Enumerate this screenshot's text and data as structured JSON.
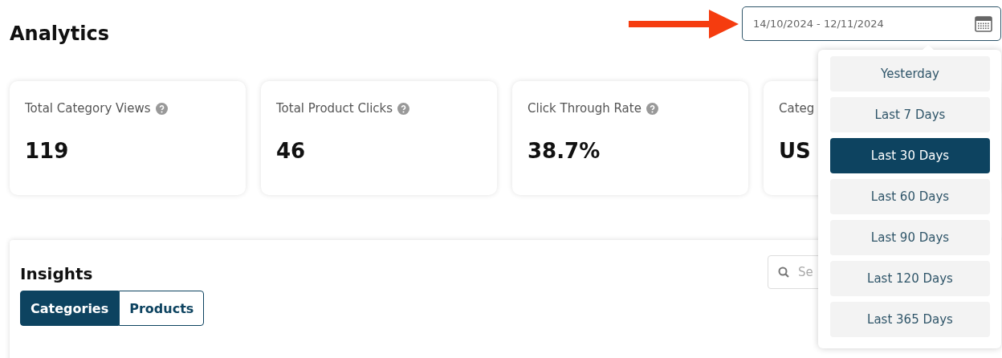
{
  "page": {
    "title": "Analytics"
  },
  "date_range": {
    "value": "14/10/2024 - 12/11/2024"
  },
  "stats": [
    {
      "label": "Total Category Views",
      "help": true,
      "value": "119"
    },
    {
      "label": "Total Product Clicks",
      "help": true,
      "value": "46"
    },
    {
      "label": "Click Through Rate",
      "help": true,
      "value": "38.7%"
    },
    {
      "label": "Categ",
      "help": false,
      "value": "US"
    }
  ],
  "insights": {
    "title": "Insights",
    "search": {
      "placeholder": "Se"
    },
    "tabs": [
      {
        "label": "Categories",
        "selected": true
      },
      {
        "label": "Products",
        "selected": false
      }
    ]
  },
  "range_menu": [
    {
      "label": "Yesterday",
      "selected": false
    },
    {
      "label": "Last 7 Days",
      "selected": false
    },
    {
      "label": "Last 30 Days",
      "selected": true
    },
    {
      "label": "Last 60 Days",
      "selected": false
    },
    {
      "label": "Last 90 Days",
      "selected": false
    },
    {
      "label": "Last 120 Days",
      "selected": false
    },
    {
      "label": "Last 365 Days",
      "selected": false
    }
  ]
}
